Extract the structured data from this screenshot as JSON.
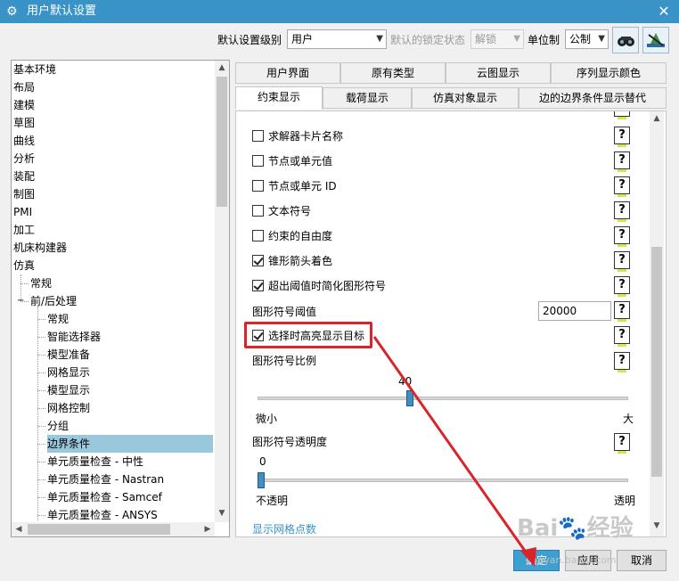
{
  "window": {
    "title": "用户默认设置",
    "close": "✕",
    "icon": "gear-icon"
  },
  "toolbar": {
    "level_label": "默认设置级别",
    "level_value": "用户",
    "lock_label": "默认的锁定状态",
    "lock_value": "解锁",
    "unit_label": "单位制",
    "unit_value": "公制",
    "tool1_icon": "find-icon",
    "tool2_icon": "manage-icon"
  },
  "tree": {
    "items": [
      {
        "label": "基本环境"
      },
      {
        "label": "布局"
      },
      {
        "label": "建模"
      },
      {
        "label": "草图"
      },
      {
        "label": "曲线"
      },
      {
        "label": "分析"
      },
      {
        "label": "装配"
      },
      {
        "label": "制图"
      },
      {
        "label": "PMI"
      },
      {
        "label": "加工"
      },
      {
        "label": "机床构建器"
      },
      {
        "label": "仿真"
      },
      {
        "label": "常规"
      },
      {
        "label": "前/后处理"
      },
      {
        "label": "常规"
      },
      {
        "label": "智能选择器"
      },
      {
        "label": "模型准备"
      },
      {
        "label": "网格显示"
      },
      {
        "label": "模型显示"
      },
      {
        "label": "网格控制"
      },
      {
        "label": "分组"
      },
      {
        "label": "边界条件"
      },
      {
        "label": "单元质量检查 - 中性"
      },
      {
        "label": "单元质量检查 - Nastran"
      },
      {
        "label": "单元质量检查 - Samcef"
      },
      {
        "label": "单元质量检查 - ANSYS"
      }
    ],
    "expander": "−"
  },
  "tabs_row1": [
    "用户界面",
    "原有类型",
    "云图显示",
    "序列显示颜色"
  ],
  "tabs_row2": [
    "约束显示",
    "载荷显示",
    "仿真对象显示",
    "边的边界条件显示替代"
  ],
  "panel": {
    "checkboxes": [
      {
        "label": "求解器卡片名称",
        "checked": false
      },
      {
        "label": "节点或单元值",
        "checked": false
      },
      {
        "label": "节点或单元 ID",
        "checked": false
      },
      {
        "label": "文本符号",
        "checked": false
      },
      {
        "label": "约束的自由度",
        "checked": false
      },
      {
        "label": "锥形箭头着色",
        "checked": true
      },
      {
        "label": "超出阈值时简化图形符号",
        "checked": true
      }
    ],
    "threshold_label": "图形符号阈值",
    "threshold_value": "20000",
    "highlight_label": "选择时高亮显示目标",
    "highlight_checked": true,
    "scale_label": "图形符号比例",
    "scale_value": "40",
    "scale_level": 40,
    "scale_min": "微小",
    "scale_max": "大",
    "transparency_label": "图形符号透明度",
    "transparency_value": "0",
    "transparency_level": 0,
    "transparency_min": "不透明",
    "transparency_max": "透明",
    "cut_label": "显示网格点数",
    "help": "?"
  },
  "buttons": {
    "ok": "确定",
    "apply": "应用",
    "cancel": "取消"
  },
  "watermark": {
    "text": "Bai🐾经验",
    "sub": "jingyan.baidu.com"
  },
  "colors": {
    "title_bar": "#3a93c7",
    "selection": "#99c7dc",
    "annotation": "#d9242b"
  }
}
